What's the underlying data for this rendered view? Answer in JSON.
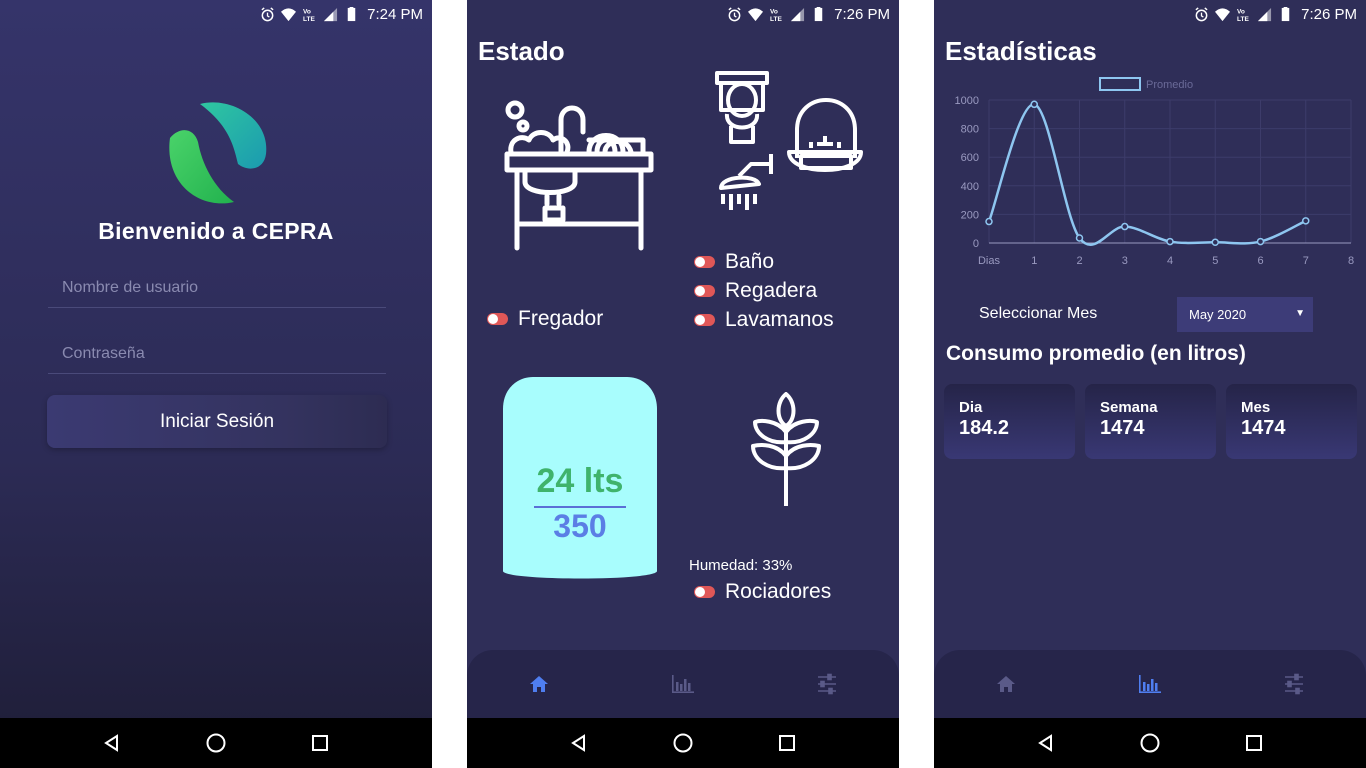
{
  "status": {
    "screen1_time": "7:24 PM",
    "screen2_time": "7:26 PM",
    "screen3_time": "7:26 PM",
    "icons": [
      "alarm-icon",
      "wifi-icon",
      "volte-icon",
      "signal-icon",
      "battery-icon"
    ]
  },
  "login": {
    "welcome": "Bienvenido a CEPRA",
    "username_placeholder": "Nombre de usuario",
    "password_placeholder": "Contraseña",
    "login_button": "Iniciar Sesión"
  },
  "estado": {
    "title": "Estado",
    "toggles": {
      "fregador": "Fregador",
      "bano": "Baño",
      "regadera": "Regadera",
      "lavamanos": "Lavamanos",
      "rociadores": "Rociadores"
    },
    "tank": {
      "level": "24 lts",
      "capacity": "350"
    },
    "humedad": "Humedad: 33%"
  },
  "estadisticas": {
    "title": "Estadísticas",
    "select_label": "Seleccionar Mes",
    "select_value": "May 2020",
    "subtitle": "Consumo promedio (en litros)",
    "cards": [
      {
        "label": "Dia",
        "value": "184.2"
      },
      {
        "label": "Semana",
        "value": "1474"
      },
      {
        "label": "Mes",
        "value": "1474"
      }
    ]
  },
  "colors": {
    "background": "#2f2e58",
    "toggle_off": "#e05757",
    "tank": "#a8fdfd",
    "tank_level": "#3fb36c",
    "tank_capacity": "#5b7ee5",
    "chart_line": "#8ec6f0",
    "nav_active": "#4f7ef0"
  },
  "chart_data": {
    "type": "line",
    "legend": [
      "Promedio"
    ],
    "legend_position": "top-center",
    "x_tick_labels": [
      "Dias",
      "1",
      "2",
      "3",
      "4",
      "5",
      "6",
      "7",
      "8"
    ],
    "y_tick_labels": [
      "0",
      "200",
      "400",
      "600",
      "800",
      "1000"
    ],
    "ylim": [
      0,
      1000
    ],
    "series": [
      {
        "name": "Promedio",
        "x": [
          0,
          1,
          2,
          3,
          4,
          5,
          6,
          7
        ],
        "values": [
          150,
          970,
          35,
          115,
          10,
          5,
          10,
          155
        ]
      }
    ],
    "grid": true
  }
}
